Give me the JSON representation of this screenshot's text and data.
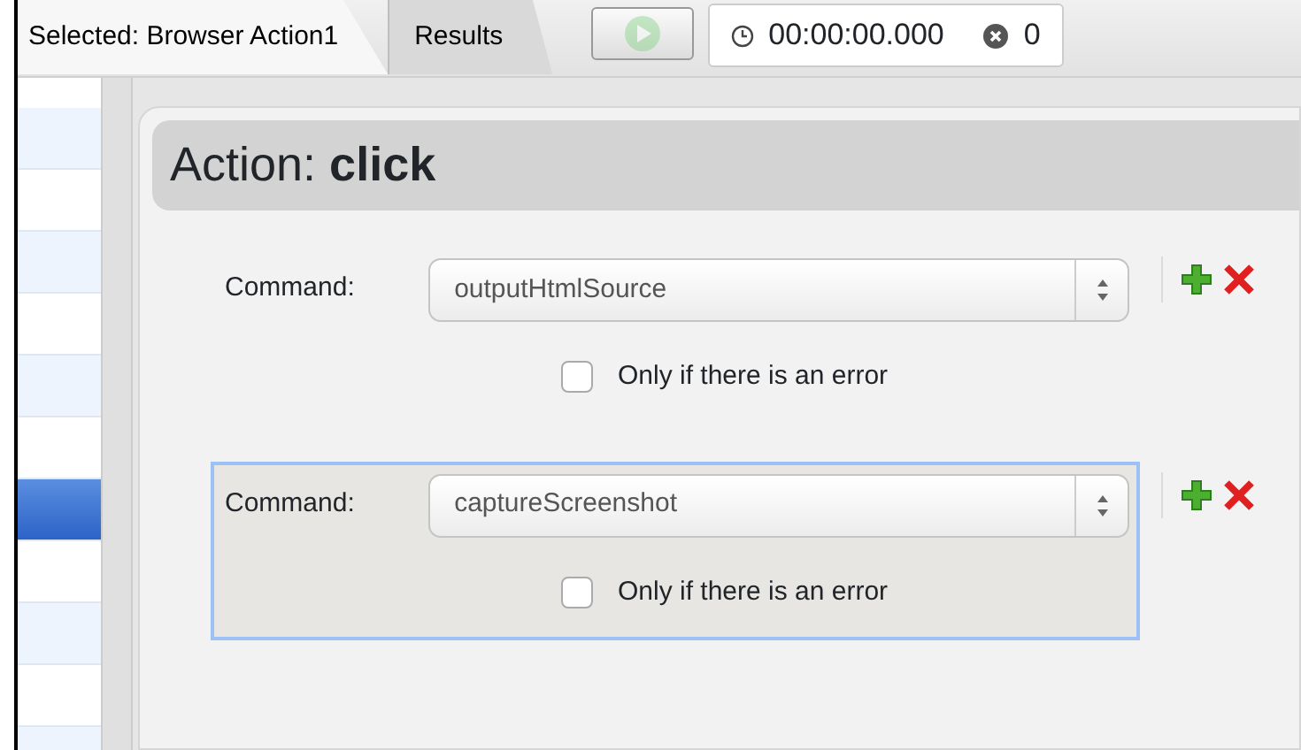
{
  "tabs": [
    {
      "label": "Selected: Browser Action1",
      "selected": true
    },
    {
      "label": "Results",
      "selected": false
    }
  ],
  "toolbar": {
    "play_disabled": true,
    "timer": "00:00:00.000",
    "error_count": "0"
  },
  "sidebar": {
    "rows": [
      {
        "selected": false
      },
      {
        "selected": false
      },
      {
        "selected": false
      },
      {
        "selected": false
      },
      {
        "selected": false
      },
      {
        "selected": false
      },
      {
        "selected": true
      },
      {
        "selected": false
      },
      {
        "selected": false
      },
      {
        "selected": false
      },
      {
        "selected": false
      }
    ]
  },
  "action": {
    "title": "Action: **click**",
    "commands": [
      {
        "label": "Command:",
        "value": "outputHtmlSource",
        "option_label": "Only if there is an error",
        "checked": false,
        "selected": false
      },
      {
        "label": "Command:",
        "value": "captureScreenshot",
        "option_label": "Only if there is an error",
        "checked": false,
        "selected": true
      }
    ]
  }
}
